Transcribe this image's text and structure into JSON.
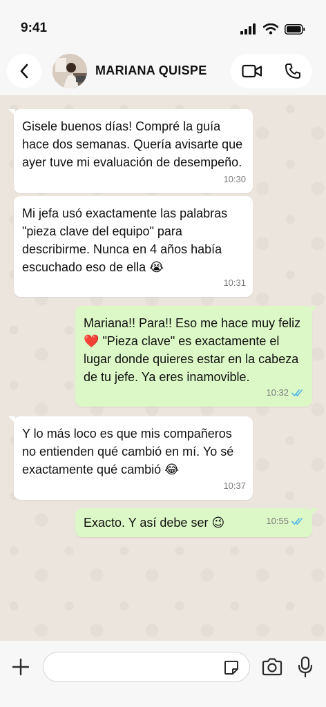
{
  "status_bar": {
    "time": "9:41"
  },
  "header": {
    "back_icon": "chevron-left-icon",
    "contact_name": "MARIANA QUISPE",
    "video_icon": "video-call-icon",
    "phone_icon": "phone-icon"
  },
  "colors": {
    "incoming_bubble": "#FFFFFF",
    "outgoing_bubble": "#DCF8C6",
    "read_ticks": "#4FB6EC",
    "chat_background": "#ECE5DD"
  },
  "messages": [
    {
      "direction": "incoming",
      "text": "Gisele buenos días! Compré la guía hace dos semanas. Quería avisarte que ayer tuve mi evaluación de desempeño.",
      "time": "10:30"
    },
    {
      "direction": "incoming",
      "text": "Mi jefa usó exactamente las palabras \"pieza clave del equipo\" para describirme. Nunca en 4 años había escuchado eso de ella",
      "emoji": "😭",
      "time": "10:31"
    },
    {
      "direction": "outgoing",
      "text_a": "Mariana!! Para!! Eso me hace muy feliz",
      "emoji": "❤️",
      "text_b": "\"Pieza clave\" es exactamente el lugar donde quieres estar en la cabeza de tu jefe. Ya eres inamovible.",
      "time": "10:32",
      "status": "read"
    },
    {
      "direction": "incoming",
      "text": "Y lo más loco es que mis compañeros no entienden qué cambió en mí. Yo sé exactamente qué cambió",
      "emoji": "😂",
      "time": "10:37"
    },
    {
      "direction": "outgoing",
      "text": "Exacto. Y así debe ser",
      "emoji": "😉",
      "time": "10:55",
      "status": "read"
    }
  ],
  "input_bar": {
    "plus_icon": "plus-icon",
    "placeholder": "",
    "sticker_icon": "sticker-icon",
    "camera_icon": "camera-icon",
    "mic_icon": "microphone-icon"
  }
}
